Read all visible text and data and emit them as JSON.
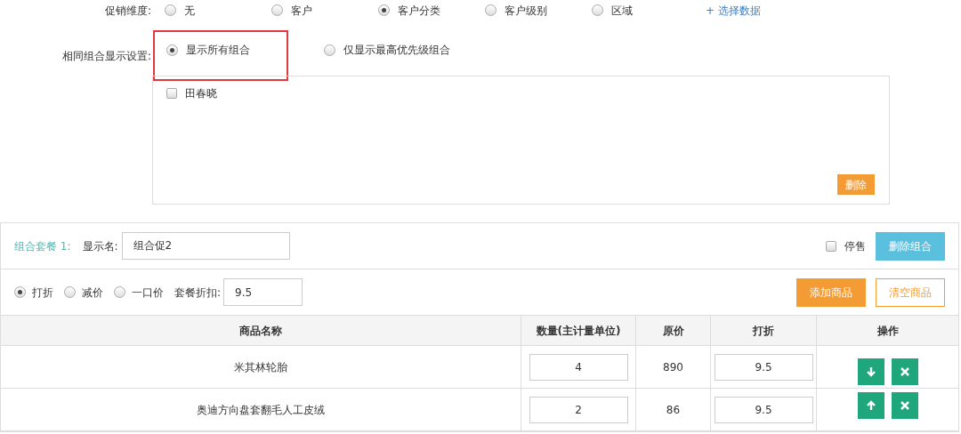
{
  "dimension": {
    "label": "促销维度:",
    "options": [
      {
        "label": "无",
        "selected": false
      },
      {
        "label": "客户",
        "selected": false
      },
      {
        "label": "客户分类",
        "selected": true
      },
      {
        "label": "客户级别",
        "selected": false
      },
      {
        "label": "区域",
        "selected": false
      }
    ],
    "link": "+ 选择数据"
  },
  "combo_display": {
    "label": "相同组合显示设置:",
    "highlighted": true,
    "options": [
      {
        "label": "显示所有组合",
        "selected": true
      },
      {
        "label": "仅显示最高优先级组合",
        "selected": false
      }
    ]
  },
  "selected_items": {
    "items": [
      {
        "label": "田春晓",
        "checked": false
      }
    ],
    "delete_button": "删除"
  },
  "package": {
    "title": "组合套餐 1:",
    "name_label": "显示名:",
    "name_value": "组合促2",
    "stop_sale": {
      "label": "停售",
      "checked": false
    },
    "delete_button": "删除组合",
    "price_modes": [
      {
        "label": "打折",
        "selected": true
      },
      {
        "label": "减价",
        "selected": false
      },
      {
        "label": "一口价",
        "selected": false
      }
    ],
    "discount_label": "套餐折扣:",
    "discount_value": "9.5",
    "add_button": "添加商品",
    "clear_button": "清空商品",
    "table": {
      "columns": [
        "商品名称",
        "数量(主计量单位)",
        "原价",
        "打折",
        "操作"
      ],
      "rows": [
        {
          "name": "米其林轮胎",
          "quantity": "4",
          "price": "890",
          "discount": "9.5",
          "kind": "move-down"
        },
        {
          "name": "奥迪方向盘套翻毛人工皮绒",
          "quantity": "2",
          "price": "86",
          "discount": "9.5",
          "kind": "move-up"
        }
      ]
    }
  }
}
